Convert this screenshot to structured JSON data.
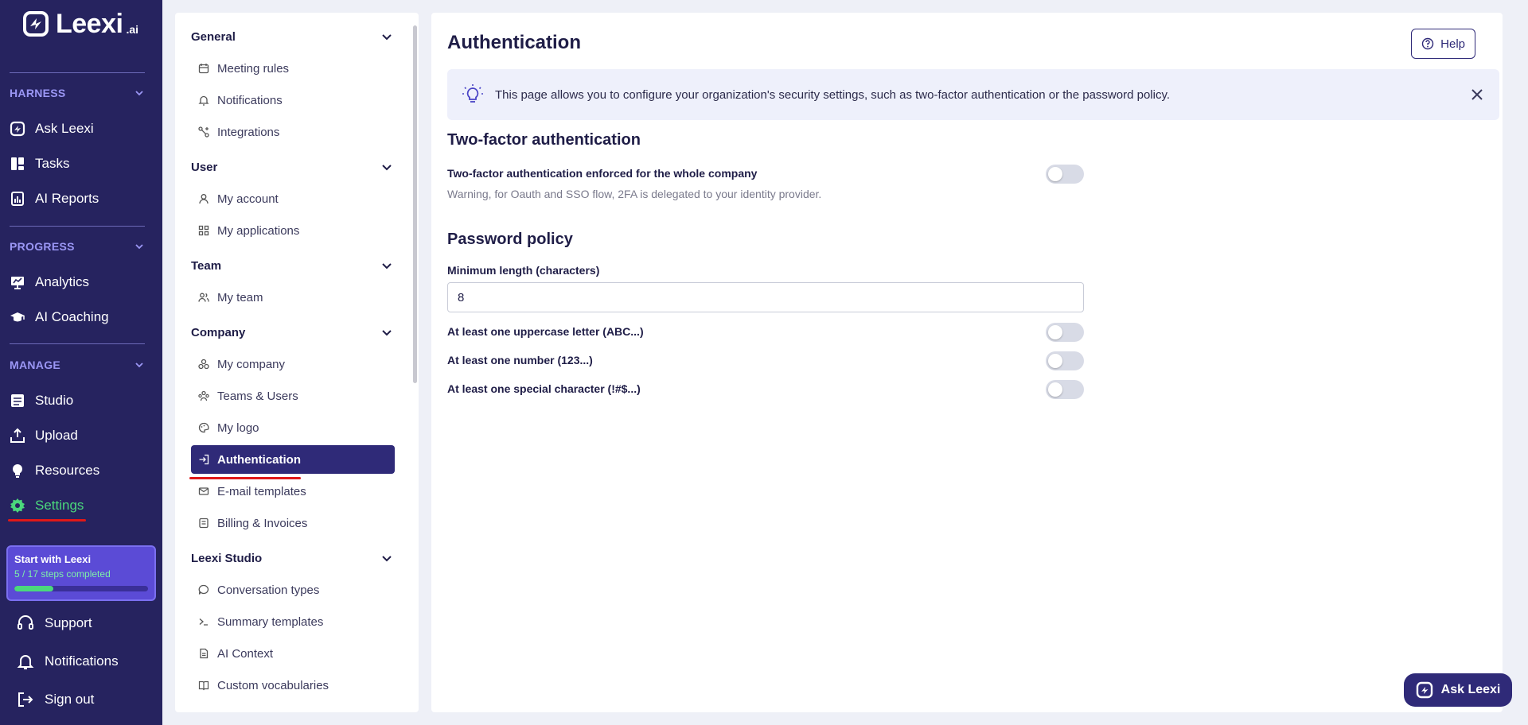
{
  "brand": {
    "name": "Leexi",
    "suffix": ".ai"
  },
  "nav": {
    "sections": [
      {
        "label": "HARNESS",
        "items": [
          {
            "label": "Ask Leexi",
            "icon": "leexi-icon"
          },
          {
            "label": "Tasks",
            "icon": "tasks-icon"
          },
          {
            "label": "AI Reports",
            "icon": "reports-icon"
          }
        ]
      },
      {
        "label": "PROGRESS",
        "items": [
          {
            "label": "Analytics",
            "icon": "analytics-icon"
          },
          {
            "label": "AI Coaching",
            "icon": "coaching-icon"
          }
        ]
      },
      {
        "label": "MANAGE",
        "items": [
          {
            "label": "Studio",
            "icon": "studio-icon"
          },
          {
            "label": "Upload",
            "icon": "upload-icon"
          },
          {
            "label": "Resources",
            "icon": "bulb-icon"
          },
          {
            "label": "Settings",
            "icon": "gear-icon"
          }
        ]
      }
    ],
    "onboarding": {
      "title": "Start with Leexi",
      "progress_text": "5 / 17 steps completed",
      "progress": 0.294
    },
    "bottom": {
      "support": "Support",
      "notifications": "Notifications",
      "signout": "Sign out"
    }
  },
  "menu": {
    "groups": [
      {
        "label": "General",
        "items": [
          "Meeting rules",
          "Notifications",
          "Integrations"
        ]
      },
      {
        "label": "User",
        "items": [
          "My account",
          "My applications"
        ]
      },
      {
        "label": "Team",
        "items": [
          "My team"
        ]
      },
      {
        "label": "Company",
        "items": [
          "My company",
          "Teams & Users",
          "My logo",
          "Authentication",
          "E-mail templates",
          "Billing & Invoices"
        ]
      },
      {
        "label": "Leexi Studio",
        "items": [
          "Conversation types",
          "Summary templates",
          "AI Context",
          "Custom vocabularies"
        ]
      }
    ],
    "active": "Authentication"
  },
  "main": {
    "title": "Authentication",
    "help_label": "Help",
    "info_text": "This page allows you to configure your organization's security settings, such as two-factor authentication or the password policy.",
    "twofa": {
      "heading": "Two-factor authentication",
      "enforce_label": "Two-factor authentication enforced for the whole company",
      "enforce_on": false,
      "warning": "Warning, for Oauth and SSO flow, 2FA is delegated to your identity provider."
    },
    "password": {
      "heading": "Password policy",
      "min_length_label": "Minimum length (characters)",
      "min_length_value": "8",
      "uppercase_label": "At least one uppercase letter (ABC...)",
      "uppercase_on": false,
      "number_label": "At least one number (123...)",
      "number_on": false,
      "special_label": "At least one special character (!#$...)",
      "special_on": false
    }
  },
  "ask_button": "Ask Leexi",
  "colors": {
    "nav_bg": "#26235f",
    "accent": "#2f2a78",
    "active_green": "#4bd87c",
    "section_purple": "#9b97f5",
    "highlight_red": "#e01818"
  }
}
